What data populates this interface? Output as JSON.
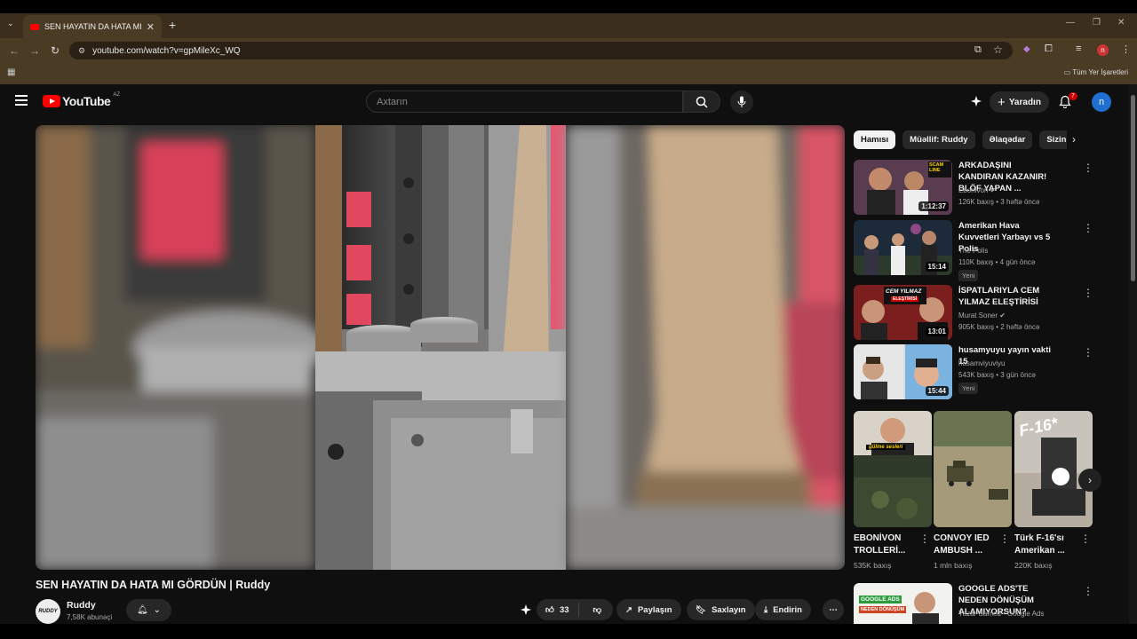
{
  "browser": {
    "tab_title": "SEN HAYATIN DA HATA MI GÖRDÜN",
    "url": "youtube.com/watch?v=gpMileXc_WQ",
    "bookmarks_all": "Tüm Yer İşaretleri"
  },
  "header": {
    "logo_text": "YouTube",
    "country_code": "AZ",
    "search_placeholder": "Axtarın",
    "create_label": "Yaradın",
    "notif_count": "7",
    "avatar_letter": "n"
  },
  "video": {
    "title": "SEN HAYATIN DA HATA MI GÖRDÜN | Ruddy",
    "channel": "Ruddy",
    "channel_logo": "RUDDY",
    "subscribers": "7,58K abunəçi",
    "likes": "33",
    "share": "Paylaşın",
    "save": "Saxlayın",
    "download": "Endirin"
  },
  "chips": [
    "Hamısı",
    "Müəllif: Ruddy",
    "Əlaqədar",
    "Sizin üçün"
  ],
  "recs": [
    {
      "title": "ARKADAŞINI KANDIRAN KAZANIR! BLÖF YAPAN ...",
      "channel": "Ebonivon",
      "verified": true,
      "meta": "126K baxış • 3 həftə öncə",
      "duration": "1:12:37",
      "new": ""
    },
    {
      "title": "Amerikan Hava Kuvvetleri Yarbayı vs 5 Polis",
      "channel": "The Polis",
      "verified": false,
      "meta": "110K baxış • 4 gün öncə",
      "duration": "15:14",
      "new": "Yeni"
    },
    {
      "title": "İSPATLARIYLA CEM YILMAZ ELEŞTİRİSİ",
      "channel": "Murat Soner",
      "verified": true,
      "meta": "905K baxış • 2 həftə öncə",
      "duration": "13:01",
      "new": ""
    },
    {
      "title": "husamyuyu yayın vakti 15",
      "channel": "husamviyuviyu",
      "verified": false,
      "meta": "543K baxış • 3 gün öncə",
      "duration": "15:44",
      "new": "Yeni"
    }
  ],
  "thumb_texts": {
    "scam": "SCAM LINE",
    "cem": "CEM YILMAZ",
    "cem2": "ELEŞTİRİSİ",
    "f16": "F-16*",
    "sub": "gülme sesleri",
    "ads": "GOOGLE ADS",
    "ads2": "NEDEN DÖNÜŞÜM"
  },
  "shorts": [
    {
      "title": "EBONİVON TROLLERİ...",
      "views": "535K baxış"
    },
    {
      "title": "CONVOY IED AMBUSH ...",
      "views": "1 mln baxış"
    },
    {
      "title": "Türk F-16'sı Amerikan ...",
      "views": "220K baxış"
    }
  ],
  "bottom_rec": {
    "title": "GOOGLE ADS'TE NEDEN DÖNÜŞÜM ALAMIYORSUN?",
    "channel": "Yazar Samed - Google Ads"
  }
}
